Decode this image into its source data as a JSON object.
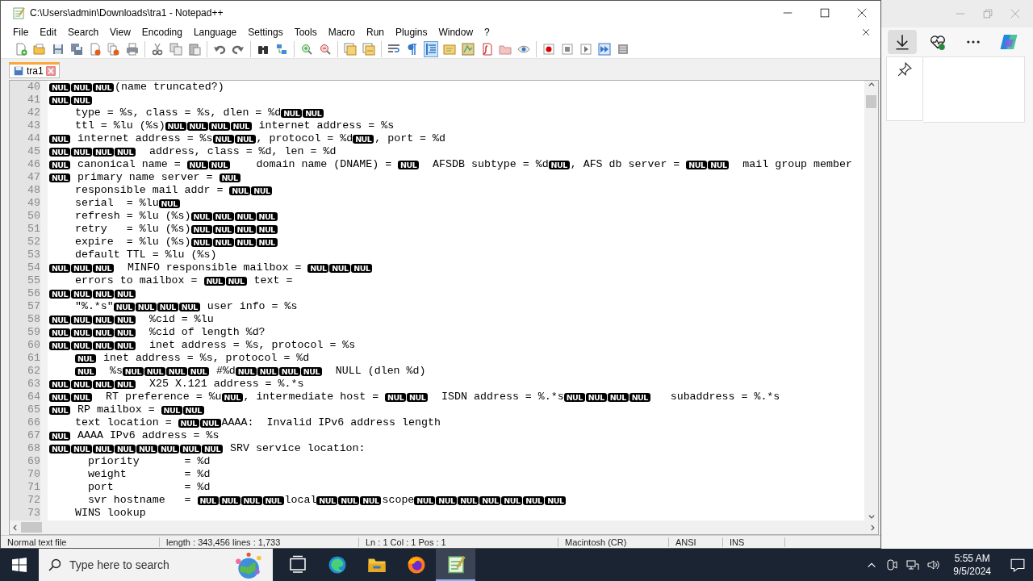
{
  "window": {
    "title": "C:\\Users\\admin\\Downloads\\tra1 - Notepad++"
  },
  "menu": [
    "File",
    "Edit",
    "Search",
    "View",
    "Encoding",
    "Language",
    "Settings",
    "Tools",
    "Macro",
    "Run",
    "Plugins",
    "Window",
    "?"
  ],
  "toolbar": [
    [
      {
        "kind": "new",
        "selected": false
      },
      {
        "kind": "open",
        "selected": false
      },
      {
        "kind": "save",
        "selected": false
      },
      {
        "kind": "saveall",
        "selected": false
      },
      {
        "kind": "close",
        "selected": false
      },
      {
        "kind": "closeall",
        "selected": false
      },
      {
        "kind": "print",
        "selected": false
      }
    ],
    [
      {
        "kind": "cut",
        "selected": false
      },
      {
        "kind": "copy",
        "selected": false
      },
      {
        "kind": "paste",
        "selected": false
      }
    ],
    [
      {
        "kind": "undo",
        "selected": false
      },
      {
        "kind": "redo",
        "selected": false
      }
    ],
    [
      {
        "kind": "find",
        "selected": false
      },
      {
        "kind": "replace",
        "selected": false
      }
    ],
    [
      {
        "kind": "zoomin",
        "selected": false
      },
      {
        "kind": "zoomout",
        "selected": false
      }
    ],
    [
      {
        "kind": "syncv",
        "selected": false
      },
      {
        "kind": "synch",
        "selected": false
      }
    ],
    [
      {
        "kind": "wrap",
        "selected": false
      },
      {
        "kind": "allchars",
        "selected": false
      },
      {
        "kind": "indent",
        "selected": true
      },
      {
        "kind": "udl",
        "selected": false
      },
      {
        "kind": "docmap",
        "selected": false
      },
      {
        "kind": "funclist",
        "selected": false
      },
      {
        "kind": "folder",
        "selected": false
      },
      {
        "kind": "monitor",
        "selected": false
      }
    ],
    [
      {
        "kind": "record",
        "selected": false
      },
      {
        "kind": "stop",
        "selected": false
      },
      {
        "kind": "play",
        "selected": false
      },
      {
        "kind": "playmulti",
        "selected": false
      },
      {
        "kind": "savemacro",
        "selected": false
      }
    ]
  ],
  "tabs": [
    {
      "label": "tra1",
      "selected": true
    }
  ],
  "lines": [
    {
      "number": "40",
      "segments": [
        {
          "kind": "nul",
          "text": "NUL"
        },
        {
          "kind": "nul",
          "text": "NUL"
        },
        {
          "kind": "nul",
          "text": "NUL"
        },
        {
          "kind": "text",
          "text": "(name truncated?)"
        }
      ]
    },
    {
      "number": "41",
      "segments": [
        {
          "kind": "nul",
          "text": "NUL"
        },
        {
          "kind": "nul",
          "text": "NUL"
        }
      ]
    },
    {
      "number": "42",
      "segments": [
        {
          "kind": "text",
          "text": "    type = %s, class = %s, dlen = %d"
        },
        {
          "kind": "nul",
          "text": "NUL"
        },
        {
          "kind": "nul",
          "text": "NUL"
        }
      ]
    },
    {
      "number": "43",
      "segments": [
        {
          "kind": "text",
          "text": "    ttl = %lu (%s)"
        },
        {
          "kind": "nul",
          "text": "NUL"
        },
        {
          "kind": "nul",
          "text": "NUL"
        },
        {
          "kind": "nul",
          "text": "NUL"
        },
        {
          "kind": "nul",
          "text": "NUL"
        },
        {
          "kind": "text",
          "text": " internet address = %s"
        }
      ]
    },
    {
      "number": "44",
      "segments": [
        {
          "kind": "nul",
          "text": "NUL"
        },
        {
          "kind": "text",
          "text": " internet address = %s"
        },
        {
          "kind": "nul",
          "text": "NUL"
        },
        {
          "kind": "nul",
          "text": "NUL"
        },
        {
          "kind": "text",
          "text": ", protocol = %d"
        },
        {
          "kind": "nul",
          "text": "NUL"
        },
        {
          "kind": "text",
          "text": ", port = %d"
        }
      ]
    },
    {
      "number": "45",
      "segments": [
        {
          "kind": "nul",
          "text": "NUL"
        },
        {
          "kind": "nul",
          "text": "NUL"
        },
        {
          "kind": "nul",
          "text": "NUL"
        },
        {
          "kind": "nul",
          "text": "NUL"
        },
        {
          "kind": "text",
          "text": "  address, class = %d, len = %d"
        }
      ]
    },
    {
      "number": "46",
      "segments": [
        {
          "kind": "nul",
          "text": "NUL"
        },
        {
          "kind": "text",
          "text": " canonical name = "
        },
        {
          "kind": "nul",
          "text": "NUL"
        },
        {
          "kind": "nul",
          "text": "NUL"
        },
        {
          "kind": "text",
          "text": "    domain name (DNAME) = "
        },
        {
          "kind": "nul",
          "text": "NUL"
        },
        {
          "kind": "text",
          "text": "  AFSDB subtype = %d"
        },
        {
          "kind": "nul",
          "text": "NUL"
        },
        {
          "kind": "text",
          "text": ", AFS db server = "
        },
        {
          "kind": "nul",
          "text": "NUL"
        },
        {
          "kind": "nul",
          "text": "NUL"
        },
        {
          "kind": "text",
          "text": "  mail group member"
        }
      ]
    },
    {
      "number": "47",
      "segments": [
        {
          "kind": "nul",
          "text": "NUL"
        },
        {
          "kind": "text",
          "text": " primary name server = "
        },
        {
          "kind": "nul",
          "text": "NUL"
        }
      ]
    },
    {
      "number": "48",
      "segments": [
        {
          "kind": "text",
          "text": "    responsible mail addr = "
        },
        {
          "kind": "nul",
          "text": "NUL"
        },
        {
          "kind": "nul",
          "text": "NUL"
        }
      ]
    },
    {
      "number": "49",
      "segments": [
        {
          "kind": "text",
          "text": "    serial  = %lu"
        },
        {
          "kind": "nul",
          "text": "NUL"
        }
      ]
    },
    {
      "number": "50",
      "segments": [
        {
          "kind": "text",
          "text": "    refresh = %lu (%s)"
        },
        {
          "kind": "nul",
          "text": "NUL"
        },
        {
          "kind": "nul",
          "text": "NUL"
        },
        {
          "kind": "nul",
          "text": "NUL"
        },
        {
          "kind": "nul",
          "text": "NUL"
        }
      ]
    },
    {
      "number": "51",
      "segments": [
        {
          "kind": "text",
          "text": "    retry   = %lu (%s)"
        },
        {
          "kind": "nul",
          "text": "NUL"
        },
        {
          "kind": "nul",
          "text": "NUL"
        },
        {
          "kind": "nul",
          "text": "NUL"
        },
        {
          "kind": "nul",
          "text": "NUL"
        }
      ]
    },
    {
      "number": "52",
      "segments": [
        {
          "kind": "text",
          "text": "    expire  = %lu (%s)"
        },
        {
          "kind": "nul",
          "text": "NUL"
        },
        {
          "kind": "nul",
          "text": "NUL"
        },
        {
          "kind": "nul",
          "text": "NUL"
        },
        {
          "kind": "nul",
          "text": "NUL"
        }
      ]
    },
    {
      "number": "53",
      "segments": [
        {
          "kind": "text",
          "text": "    default TTL = %lu (%s)"
        }
      ]
    },
    {
      "number": "54",
      "segments": [
        {
          "kind": "nul",
          "text": "NUL"
        },
        {
          "kind": "nul",
          "text": "NUL"
        },
        {
          "kind": "nul",
          "text": "NUL"
        },
        {
          "kind": "text",
          "text": "  MINFO responsible mailbox = "
        },
        {
          "kind": "nul",
          "text": "NUL"
        },
        {
          "kind": "nul",
          "text": "NUL"
        },
        {
          "kind": "nul",
          "text": "NUL"
        }
      ]
    },
    {
      "number": "55",
      "segments": [
        {
          "kind": "text",
          "text": "    errors to mailbox = "
        },
        {
          "kind": "nul",
          "text": "NUL"
        },
        {
          "kind": "nul",
          "text": "NUL"
        },
        {
          "kind": "text",
          "text": " text ="
        }
      ]
    },
    {
      "number": "56",
      "segments": [
        {
          "kind": "nul",
          "text": "NUL"
        },
        {
          "kind": "nul",
          "text": "NUL"
        },
        {
          "kind": "nul",
          "text": "NUL"
        },
        {
          "kind": "nul",
          "text": "NUL"
        }
      ]
    },
    {
      "number": "57",
      "segments": [
        {
          "kind": "text",
          "text": "    \"%.*s\""
        },
        {
          "kind": "nul",
          "text": "NUL"
        },
        {
          "kind": "nul",
          "text": "NUL"
        },
        {
          "kind": "nul",
          "text": "NUL"
        },
        {
          "kind": "nul",
          "text": "NUL"
        },
        {
          "kind": "text",
          "text": " user info = %s"
        }
      ]
    },
    {
      "number": "58",
      "segments": [
        {
          "kind": "nul",
          "text": "NUL"
        },
        {
          "kind": "nul",
          "text": "NUL"
        },
        {
          "kind": "nul",
          "text": "NUL"
        },
        {
          "kind": "nul",
          "text": "NUL"
        },
        {
          "kind": "text",
          "text": "  %cid = %lu"
        }
      ]
    },
    {
      "number": "59",
      "segments": [
        {
          "kind": "nul",
          "text": "NUL"
        },
        {
          "kind": "nul",
          "text": "NUL"
        },
        {
          "kind": "nul",
          "text": "NUL"
        },
        {
          "kind": "nul",
          "text": "NUL"
        },
        {
          "kind": "text",
          "text": "  %cid of length %d?"
        }
      ]
    },
    {
      "number": "60",
      "segments": [
        {
          "kind": "nul",
          "text": "NUL"
        },
        {
          "kind": "nul",
          "text": "NUL"
        },
        {
          "kind": "nul",
          "text": "NUL"
        },
        {
          "kind": "nul",
          "text": "NUL"
        },
        {
          "kind": "text",
          "text": "  inet address = %s, protocol = %s"
        }
      ]
    },
    {
      "number": "61",
      "segments": [
        {
          "kind": "indent"
        },
        {
          "kind": "nul",
          "text": "NUL"
        },
        {
          "kind": "text",
          "text": " inet address = %s, protocol = %d"
        }
      ]
    },
    {
      "number": "62",
      "segments": [
        {
          "kind": "indent"
        },
        {
          "kind": "nul",
          "text": "NUL"
        },
        {
          "kind": "text",
          "text": "  %s"
        },
        {
          "kind": "nul",
          "text": "NUL"
        },
        {
          "kind": "nul",
          "text": "NUL"
        },
        {
          "kind": "nul",
          "text": "NUL"
        },
        {
          "kind": "nul",
          "text": "NUL"
        },
        {
          "kind": "text",
          "text": " #%d"
        },
        {
          "kind": "nul",
          "text": "NUL"
        },
        {
          "kind": "nul",
          "text": "NUL"
        },
        {
          "kind": "nul",
          "text": "NUL"
        },
        {
          "kind": "nul",
          "text": "NUL"
        },
        {
          "kind": "text",
          "text": "  NULL (dlen %d)"
        }
      ]
    },
    {
      "number": "63",
      "segments": [
        {
          "kind": "nul",
          "text": "NUL"
        },
        {
          "kind": "nul",
          "text": "NUL"
        },
        {
          "kind": "nul",
          "text": "NUL"
        },
        {
          "kind": "nul",
          "text": "NUL"
        },
        {
          "kind": "text",
          "text": "  X25 X.121 address = %.*s"
        }
      ]
    },
    {
      "number": "64",
      "segments": [
        {
          "kind": "nul",
          "text": "NUL"
        },
        {
          "kind": "nul",
          "text": "NUL"
        },
        {
          "kind": "text",
          "text": "  RT preference = %u"
        },
        {
          "kind": "nul",
          "text": "NUL"
        },
        {
          "kind": "text",
          "text": ", intermediate host = "
        },
        {
          "kind": "nul",
          "text": "NUL"
        },
        {
          "kind": "nul",
          "text": "NUL"
        },
        {
          "kind": "text",
          "text": "  ISDN address = %.*s"
        },
        {
          "kind": "nul",
          "text": "NUL"
        },
        {
          "kind": "nul",
          "text": "NUL"
        },
        {
          "kind": "nul",
          "text": "NUL"
        },
        {
          "kind": "nul",
          "text": "NUL"
        },
        {
          "kind": "text",
          "text": "   subaddress = %.*s"
        }
      ]
    },
    {
      "number": "65",
      "segments": [
        {
          "kind": "nul",
          "text": "NUL"
        },
        {
          "kind": "text",
          "text": " RP mailbox = "
        },
        {
          "kind": "nul",
          "text": "NUL"
        },
        {
          "kind": "nul",
          "text": "NUL"
        }
      ]
    },
    {
      "number": "66",
      "segments": [
        {
          "kind": "text",
          "text": "    text location = "
        },
        {
          "kind": "nul",
          "text": "NUL"
        },
        {
          "kind": "nul",
          "text": "NUL"
        },
        {
          "kind": "text",
          "text": "AAAA:  Invalid IPv6 address length"
        }
      ]
    },
    {
      "number": "67",
      "segments": [
        {
          "kind": "nul",
          "text": "NUL"
        },
        {
          "kind": "text",
          "text": " AAAA IPv6 address = %s"
        }
      ]
    },
    {
      "number": "68",
      "segments": [
        {
          "kind": "nul",
          "text": "NUL"
        },
        {
          "kind": "nul",
          "text": "NUL"
        },
        {
          "kind": "nul",
          "text": "NUL"
        },
        {
          "kind": "nul",
          "text": "NUL"
        },
        {
          "kind": "nul",
          "text": "NUL"
        },
        {
          "kind": "nul",
          "text": "NUL"
        },
        {
          "kind": "nul",
          "text": "NUL"
        },
        {
          "kind": "nul",
          "text": "NUL"
        },
        {
          "kind": "text",
          "text": " SRV service location:"
        }
      ]
    },
    {
      "number": "69",
      "segments": [
        {
          "kind": "text",
          "text": "      priority       = %d"
        }
      ]
    },
    {
      "number": "70",
      "segments": [
        {
          "kind": "text",
          "text": "      weight         = %d"
        }
      ]
    },
    {
      "number": "71",
      "segments": [
        {
          "kind": "text",
          "text": "      port           = %d"
        }
      ]
    },
    {
      "number": "72",
      "segments": [
        {
          "kind": "text",
          "text": "      svr hostname   = "
        },
        {
          "kind": "nul",
          "text": "NUL"
        },
        {
          "kind": "nul",
          "text": "NUL"
        },
        {
          "kind": "nul",
          "text": "NUL"
        },
        {
          "kind": "nul",
          "text": "NUL"
        },
        {
          "kind": "text",
          "text": "local"
        },
        {
          "kind": "nul",
          "text": "NUL"
        },
        {
          "kind": "nul",
          "text": "NUL"
        },
        {
          "kind": "nul",
          "text": "NUL"
        },
        {
          "kind": "text",
          "text": "scope"
        },
        {
          "kind": "nul",
          "text": "NUL"
        },
        {
          "kind": "nul",
          "text": "NUL"
        },
        {
          "kind": "nul",
          "text": "NUL"
        },
        {
          "kind": "nul",
          "text": "NUL"
        },
        {
          "kind": "nul",
          "text": "NUL"
        },
        {
          "kind": "nul",
          "text": "NUL"
        },
        {
          "kind": "nul",
          "text": "NUL"
        }
      ]
    },
    {
      "number": "73",
      "segments": [
        {
          "kind": "text",
          "text": "    WINS lookup"
        }
      ]
    }
  ],
  "status_bar": [
    "Normal text file",
    "length : 343,456    lines : 1,733",
    "Ln : 1    Col : 1    Pos : 1",
    "Macintosh (CR)",
    "ANSI",
    "INS"
  ],
  "browser": {
    "buttons": [
      {
        "kind": "download",
        "selected": true
      },
      {
        "kind": "health",
        "selected": false
      },
      {
        "kind": "more",
        "selected": false
      },
      {
        "kind": "copilot",
        "selected": false
      }
    ]
  },
  "taskbar": {
    "search": {
      "placeholder": "Type here to search"
    },
    "apps": [
      {
        "kind": "taskview",
        "selected": false
      },
      {
        "kind": "edge",
        "selected": false
      },
      {
        "kind": "explorer",
        "selected": false
      },
      {
        "kind": "firefox",
        "selected": false
      },
      {
        "kind": "notepad",
        "selected": true
      }
    ],
    "time": "5:55 AM",
    "date": "9/5/2024"
  }
}
